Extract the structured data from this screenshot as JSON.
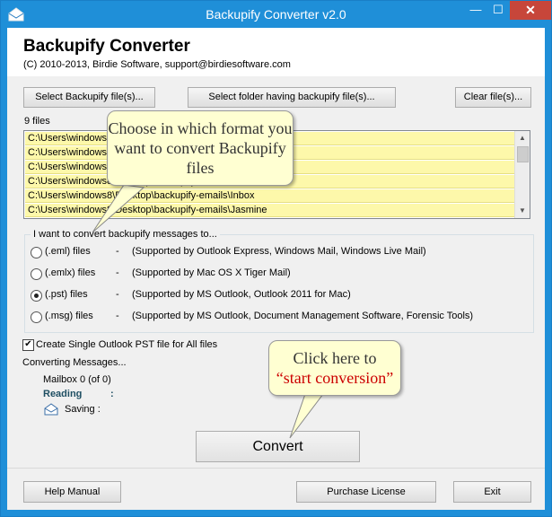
{
  "window": {
    "title": "Backupify Converter v2.0",
    "controls": {
      "minimize": "—",
      "maximize": "☐",
      "close": "✕"
    }
  },
  "header": {
    "app_name": "Backupify Converter",
    "copyright": "(C) 2010-2013, Birdie Software, support@birdiesoftware.com"
  },
  "toolbar": {
    "select_files": "Select Backupify file(s)...",
    "select_folder": "Select folder having backupify file(s)...",
    "clear_files": "Clear file(s)..."
  },
  "files": {
    "count_label": "9 files",
    "items": [
      "C:\\Users\\windows8\\Desktop\\backupify-emails\\Archive",
      "C:\\Users\\windows8\\Desktop\\backupify-emails\\Drafts",
      "C:\\Users\\windows8\\Desktop\\backupify-emails\\Family",
      "C:\\Users\\windows8\\Desktop\\backupify-emails\\Friends",
      "C:\\Users\\windows8\\Desktop\\backupify-emails\\Inbox",
      "C:\\Users\\windows8\\Desktop\\backupify-emails\\Jasmine"
    ]
  },
  "format_group": {
    "legend": "I want to convert backupify messages to...",
    "options": [
      {
        "label": "(.eml) files",
        "dash": "-",
        "desc": "(Supported by Outlook Express, Windows Mail, Windows Live Mail)"
      },
      {
        "label": "(.emlx) files",
        "dash": "-",
        "desc": "(Supported by Mac OS X Tiger Mail)"
      },
      {
        "label": "(.pst) files",
        "dash": "-",
        "desc": "(Supported by MS Outlook, Outlook 2011 for Mac)"
      },
      {
        "label": "(.msg) files",
        "dash": "-",
        "desc": "(Supported by MS Outlook, Document Management Software, Forensic Tools)"
      }
    ],
    "selected": "(.pst) files"
  },
  "single_pst": {
    "label": "Create Single Outlook PST file for All files",
    "checked": true
  },
  "status": {
    "converting": "Converting Messages...",
    "mailbox": "Mailbox  0 (of 0)",
    "reading": "Reading",
    "reading_colon": ":",
    "saving": "Saving :"
  },
  "convert_label": "Convert",
  "callouts": {
    "format": "Choose in which format you want to convert Backupify files",
    "start_line1": "Click here to",
    "start_line2": "“start conversion”"
  },
  "footer": {
    "help": "Help Manual",
    "purchase": "Purchase License",
    "exit": "Exit"
  },
  "colors": {
    "titlebar": "#1f8fd8",
    "file_row": "#fdf8aa",
    "callout_bg": "#ffffd2",
    "callout_red": "#cc0000",
    "reading": "#1e4e62",
    "close": "#c7463a"
  }
}
